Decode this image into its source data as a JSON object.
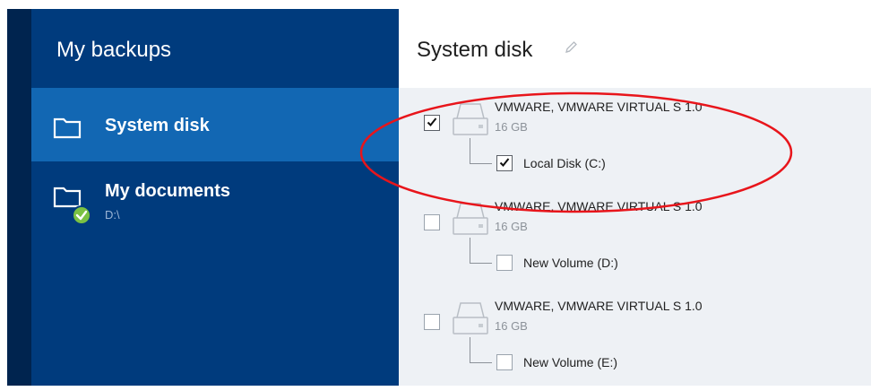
{
  "sidebar": {
    "title": "My backups",
    "items": [
      {
        "label": "System disk",
        "selected": true,
        "icon": "folder-icon"
      },
      {
        "label": "My documents",
        "sub": "D:\\",
        "icon": "folder-check-icon"
      }
    ]
  },
  "main": {
    "title": "System disk",
    "edit_icon": "pencil-icon",
    "disks": [
      {
        "name": "VMWARE, VMWARE VIRTUAL S 1.0",
        "size": "16 GB",
        "checked": true,
        "partition": {
          "name": "Local Disk (C:)",
          "checked": true
        }
      },
      {
        "name": "VMWARE, VMWARE VIRTUAL S 1.0",
        "size": "16 GB",
        "checked": false,
        "partition": {
          "name": "New Volume (D:)",
          "checked": false
        }
      },
      {
        "name": "VMWARE, VMWARE VIRTUAL S 1.0",
        "size": "16 GB",
        "checked": false,
        "partition": {
          "name": "New Volume (E:)",
          "checked": false
        }
      }
    ]
  },
  "colors": {
    "sidebar_bg": "#003b7d",
    "selected_bg": "#1267b3",
    "rail_bg": "#00244f",
    "main_bg": "#eef1f5",
    "check_badge": "#7ac143",
    "annotation_red": "#e8151b"
  }
}
